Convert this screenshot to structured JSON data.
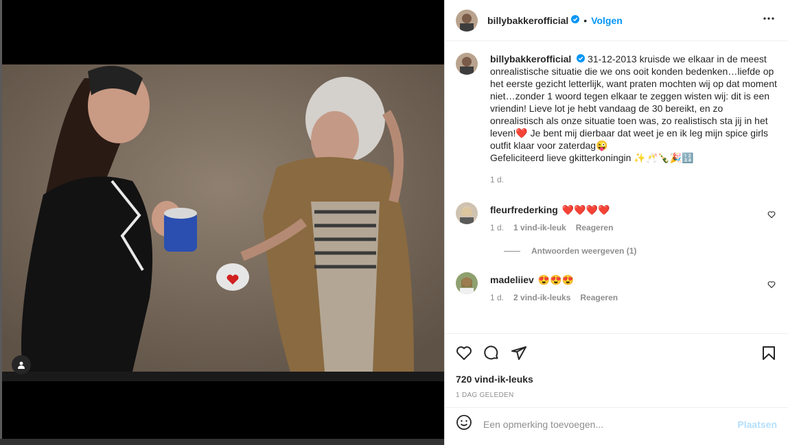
{
  "post": {
    "author": "billybakkerofficial",
    "follow_label": "Volgen",
    "dot": "•",
    "caption": "31-12-2013 kruisde we elkaar in de meest onrealistische situatie die we ons ooit konden bedenken…liefde op het eerste gezicht letterlijk, want praten mochten wij op dat moment niet…zonder 1 woord tegen elkaar te zeggen wisten wij: dit is een vriendin! Lieve lot je hebt vandaag de 30 bereikt, en zo onrealistisch als onze situatie toen was, zo realistisch sta jij in het leven!❤️ Je bent mij dierbaar dat weet je en ik leg mijn spice girls outfit klaar voor zaterdag😜\nGefeliciteerd lieve gkitterkoningin ✨🥂🍾🎉🔢",
    "caption_age": "1 d."
  },
  "comments": [
    {
      "user": "fleurfrederking",
      "text": "❤️❤️❤️❤️",
      "age": "1 d.",
      "likes": "1 vind-ik-leuk",
      "reply": "Reageren"
    },
    {
      "user": "madeliiev",
      "text": "😍😍😍",
      "age": "1 d.",
      "likes": "2 vind-ik-leuks",
      "reply": "Reageren"
    }
  ],
  "replies_toggle": "Antwoorden weergeven (1)",
  "engagement": {
    "likes": "720 vind-ik-leuks",
    "date": "1 DAG GELEDEN"
  },
  "add_comment": {
    "placeholder": "Een opmerking toevoegen...",
    "post_label": "Plaatsen"
  },
  "icons": {
    "verified": "verified-badge-icon",
    "more": "more-options-icon",
    "like": "heart-icon",
    "comment": "comment-icon",
    "share": "share-icon",
    "save": "bookmark-icon",
    "emoji": "emoji-icon",
    "user_tag": "user-tag-icon"
  },
  "colors": {
    "accent": "#0095f6",
    "accent_disabled": "#b2dffc",
    "muted": "#8e8e8e",
    "text": "#262626"
  }
}
